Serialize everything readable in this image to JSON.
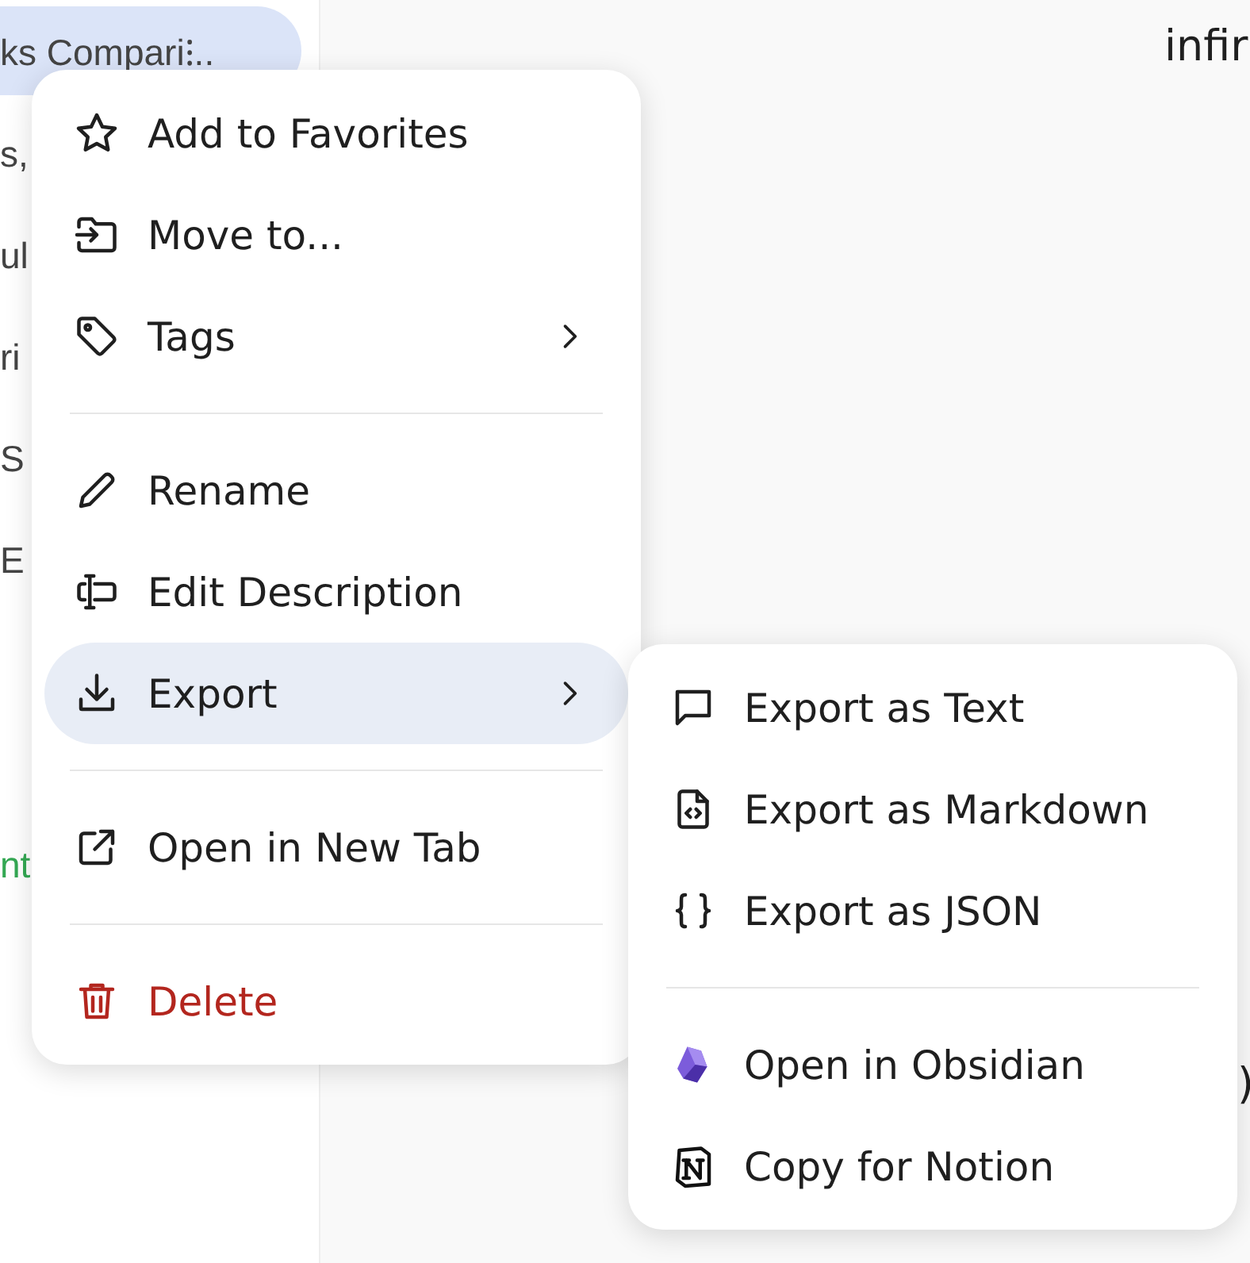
{
  "sidebar": {
    "items": [
      {
        "label": "ks Compari⁝..",
        "selected": true
      },
      {
        "label": "s,",
        "selected": false
      },
      {
        "label": "ul",
        "selected": false
      },
      {
        "label": "ri",
        "selected": false
      },
      {
        "label": "S",
        "selected": false
      },
      {
        "label": "E",
        "selected": false
      },
      {
        "label": "nt",
        "selected": false,
        "color": "#34a853"
      }
    ]
  },
  "main": {
    "texts": [
      "infir",
      ")"
    ]
  },
  "context_menu": {
    "items": [
      {
        "kind": "item",
        "label": "Add to Favorites",
        "has_submenu": false,
        "selected": false
      },
      {
        "kind": "item",
        "label": "Move to...",
        "has_submenu": false,
        "selected": false
      },
      {
        "kind": "item",
        "label": "Tags",
        "has_submenu": true,
        "selected": false
      },
      {
        "kind": "divider"
      },
      {
        "kind": "item",
        "label": "Rename",
        "has_submenu": false,
        "selected": false
      },
      {
        "kind": "item",
        "label": "Edit Description",
        "has_submenu": false,
        "selected": false
      },
      {
        "kind": "item",
        "label": "Export",
        "has_submenu": true,
        "selected": true
      },
      {
        "kind": "divider"
      },
      {
        "kind": "item",
        "label": "Open in New Tab",
        "has_submenu": false,
        "selected": false
      },
      {
        "kind": "divider"
      },
      {
        "kind": "danger",
        "label": "Delete",
        "has_submenu": false,
        "selected": false
      }
    ]
  },
  "submenu": {
    "items": [
      {
        "kind": "item",
        "label": "Export as Text"
      },
      {
        "kind": "item",
        "label": "Export as Markdown"
      },
      {
        "kind": "item",
        "label": "Export as JSON"
      },
      {
        "kind": "divider"
      },
      {
        "kind": "item",
        "label": "Open in Obsidian"
      },
      {
        "kind": "item",
        "label": "Copy for Notion"
      }
    ]
  }
}
